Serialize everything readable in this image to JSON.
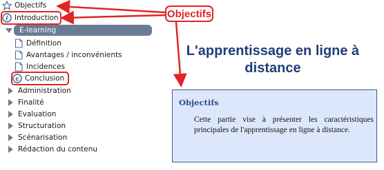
{
  "nav": {
    "top_item": "Objectifs",
    "section_open": "Introduction",
    "group": "E-learning",
    "subitems": [
      "Définition",
      "Avantages / inconvénients",
      "Incidences",
      "Conclusion"
    ],
    "sections": [
      "Administration",
      "Finalité",
      "Evaluation",
      "Structuration",
      "Scénarisation",
      "Rédaction du contenu"
    ]
  },
  "callout": {
    "label": "Objectifs"
  },
  "content": {
    "title_line1": "L'apprentissage en ligne à",
    "title_line2": "distance",
    "card_title": "Objectifs",
    "card_body": "Cette partie vise à présenter les caractéristiques principales de l'apprentissage en ligne à distance."
  },
  "colors": {
    "accent": "#e02424",
    "selected": "#6a7b95",
    "title": "#1f3d7a",
    "card_bg": "#dce7fb"
  }
}
